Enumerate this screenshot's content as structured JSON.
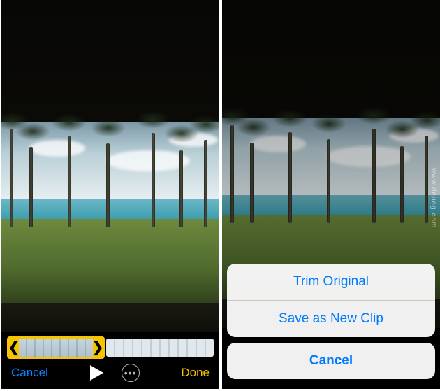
{
  "left": {
    "toolbar": {
      "cancel_label": "Cancel",
      "done_label": "Done",
      "play_icon": "play-icon",
      "more_icon": "more-options-icon",
      "trim_left_glyph": "❮",
      "trim_right_glyph": "❯"
    }
  },
  "right": {
    "action_sheet": {
      "options": [
        {
          "label": "Trim Original"
        },
        {
          "label": "Save as New Clip"
        }
      ],
      "cancel_label": "Cancel"
    }
  },
  "watermark": "www.deuag.com"
}
